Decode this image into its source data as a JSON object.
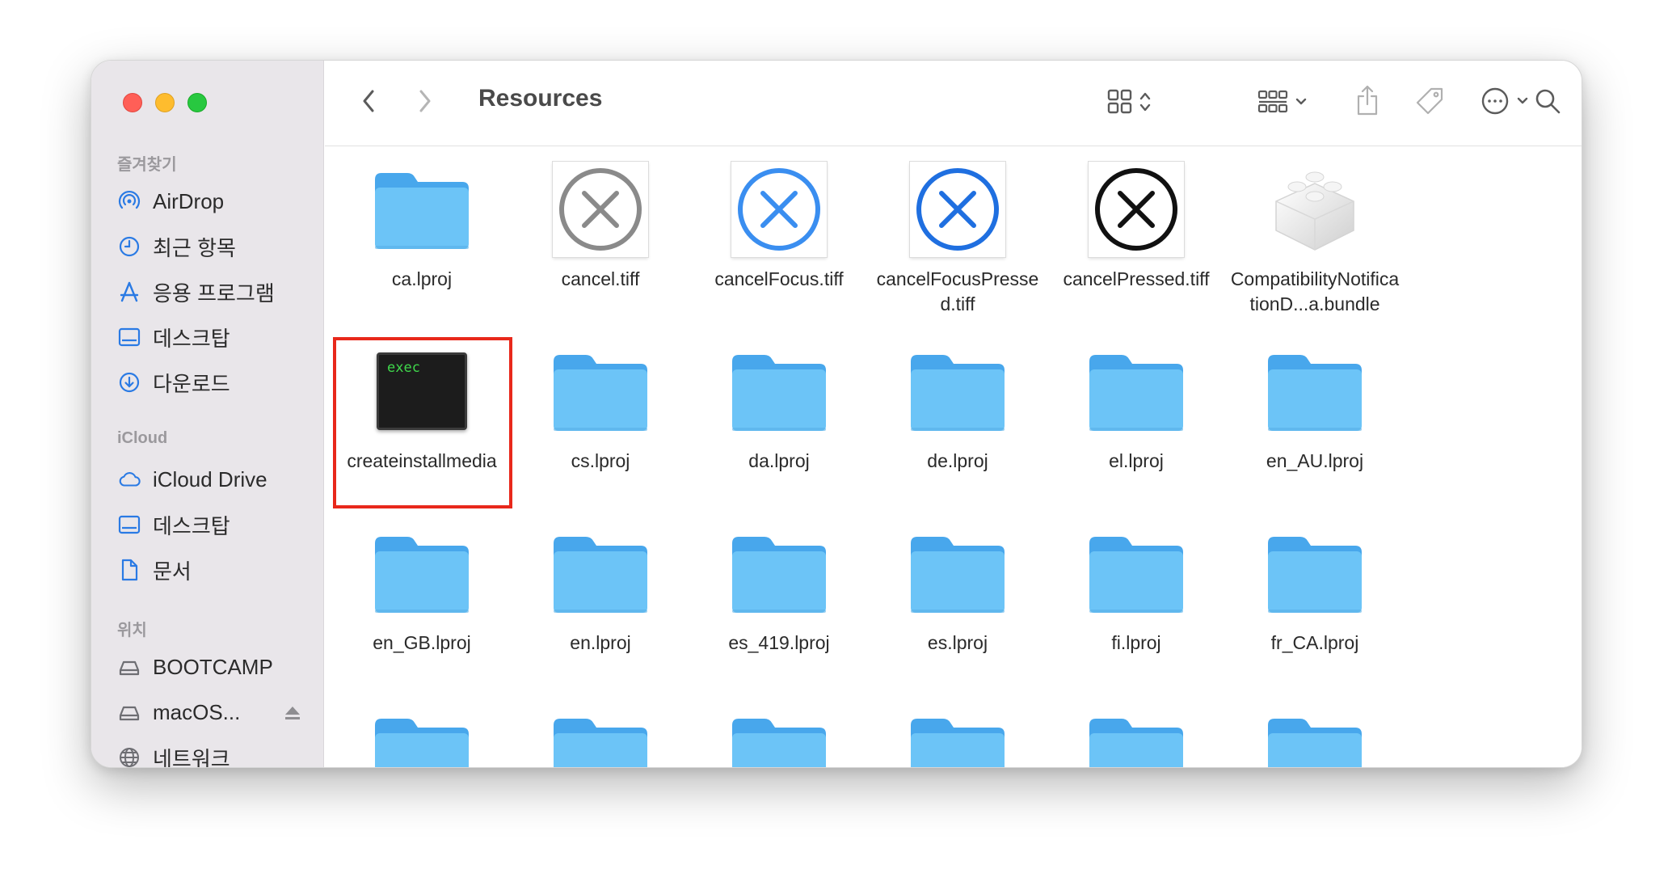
{
  "window": {
    "title": "Resources"
  },
  "sidebar": {
    "sections": [
      {
        "title": "즐겨찾기",
        "items": [
          {
            "label": "AirDrop",
            "icon": "airdrop-icon"
          },
          {
            "label": "최근 항목",
            "icon": "clock-icon"
          },
          {
            "label": "응용 프로그램",
            "icon": "applications-icon"
          },
          {
            "label": "데스크탑",
            "icon": "desktop-icon"
          },
          {
            "label": "다운로드",
            "icon": "download-icon"
          }
        ]
      },
      {
        "title": "iCloud",
        "items": [
          {
            "label": "iCloud Drive",
            "icon": "cloud-icon"
          },
          {
            "label": "데스크탑",
            "icon": "desktop-icon"
          },
          {
            "label": "문서",
            "icon": "document-icon"
          }
        ]
      },
      {
        "title": "위치",
        "items": [
          {
            "label": "BOOTCAMP",
            "icon": "disk-icon"
          },
          {
            "label": "macOS...",
            "icon": "disk-icon"
          },
          {
            "label": "네트워크",
            "icon": "network-icon"
          }
        ]
      }
    ]
  },
  "toolbar": {
    "back_icon": "chevron-left-icon",
    "forward_icon": "chevron-right-icon",
    "view_icon": "grid-view-icon",
    "group_icon": "group-view-icon",
    "share_icon": "share-icon",
    "tag_icon": "tag-icon",
    "more_icon": "ellipsis-circle-icon",
    "search_icon": "search-icon"
  },
  "files": [
    {
      "name": "ca.lproj",
      "type": "folder"
    },
    {
      "name": "cancel.tiff",
      "type": "tiff-gray"
    },
    {
      "name": "cancelFocus.tiff",
      "type": "tiff-blue"
    },
    {
      "name": "cancelFocusPressed.tiff",
      "type": "tiff-blue-dark"
    },
    {
      "name": "cancelPressed.tiff",
      "type": "tiff-black"
    },
    {
      "name": "CompatibilityNotificationD...a.bundle",
      "type": "bundle"
    },
    {
      "name": "createinstallmedia",
      "type": "exec",
      "exec_text": "exec",
      "highlighted": true
    },
    {
      "name": "cs.lproj",
      "type": "folder"
    },
    {
      "name": "da.lproj",
      "type": "folder"
    },
    {
      "name": "de.lproj",
      "type": "folder"
    },
    {
      "name": "el.lproj",
      "type": "folder"
    },
    {
      "name": "en_AU.lproj",
      "type": "folder"
    },
    {
      "name": "en_GB.lproj",
      "type": "folder"
    },
    {
      "name": "en.lproj",
      "type": "folder"
    },
    {
      "name": "es_419.lproj",
      "type": "folder"
    },
    {
      "name": "es.lproj",
      "type": "folder"
    },
    {
      "name": "fi.lproj",
      "type": "folder"
    },
    {
      "name": "fr_CA.lproj",
      "type": "folder"
    },
    {
      "name": "",
      "type": "folder"
    },
    {
      "name": "",
      "type": "folder"
    },
    {
      "name": "",
      "type": "folder"
    },
    {
      "name": "",
      "type": "folder"
    },
    {
      "name": "",
      "type": "folder"
    },
    {
      "name": "",
      "type": "folder"
    }
  ],
  "colors": {
    "folder_top": "#48a7ec",
    "folder_body": "#6cc4f7",
    "highlight": "#e8281b",
    "sidebar_accent": "#2a7ae4"
  }
}
